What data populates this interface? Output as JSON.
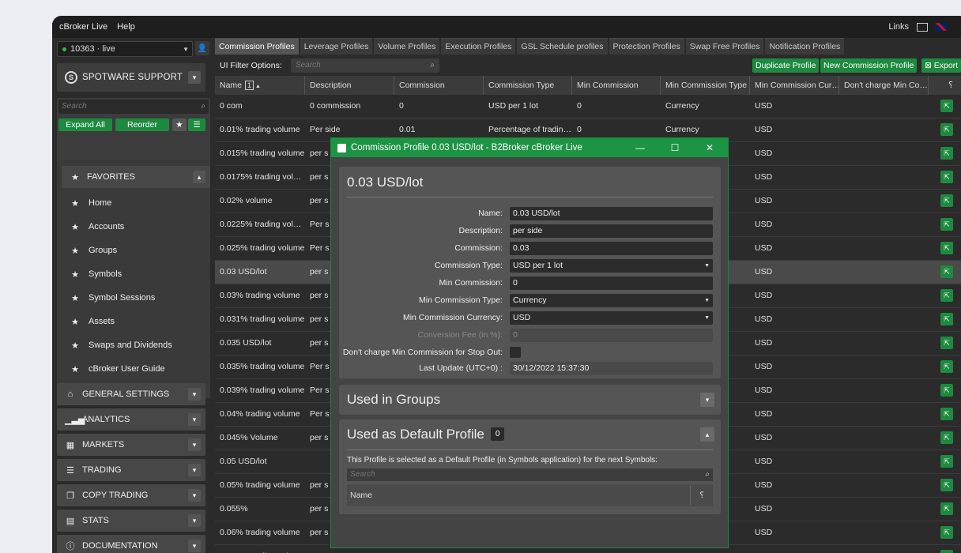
{
  "menu": {
    "app": "cBroker Live",
    "help": "Help",
    "links": "Links"
  },
  "sidebar": {
    "account": "10363 · live",
    "org": "SPOTWARE SUPPORT",
    "search_placeholder": "Search",
    "expand_all": "Expand All",
    "reorder": "Reorder",
    "favorites": "FAVORITES",
    "items": [
      "Home",
      "Accounts",
      "Groups",
      "Symbols",
      "Symbol Sessions",
      "Assets",
      "Swaps and Dividends",
      "cBroker User Guide"
    ],
    "sections": [
      "GENERAL SETTINGS",
      "ANALYTICS",
      "MARKETS",
      "TRADING",
      "COPY TRADING",
      "STATS",
      "DOCUMENTATION"
    ]
  },
  "tabs": [
    "Commission Profiles",
    "Leverage Profiles",
    "Volume Profiles",
    "Execution Profiles",
    "GSL Schedule profiles",
    "Protection Profiles",
    "Swap Free Profiles",
    "Notification Profiles"
  ],
  "filter": {
    "label": "UI Filter Options:",
    "placeholder": "Search",
    "duplicate": "Duplicate Profile",
    "new": "New Commission Profile",
    "export": "Export"
  },
  "table": {
    "columns": [
      "Name",
      "Description",
      "Commission",
      "Commission Type",
      "Min Commission",
      "Min Commission Type",
      "Min Commission Cur…",
      "Don't charge Min Co…"
    ],
    "sort_badge": "1",
    "rows": [
      [
        "0 com",
        "0 commission",
        "0",
        "USD per 1 lot",
        "0",
        "Currency",
        "USD"
      ],
      [
        "0.01% trading volume",
        "Per side",
        "0.01",
        "Percentage of tradin…",
        "0",
        "Currency",
        "USD"
      ],
      [
        "0.015% trading volume",
        "per s",
        "",
        "",
        "",
        "",
        "USD"
      ],
      [
        "0.0175% trading vol…",
        "per s",
        "",
        "",
        "",
        "",
        "USD"
      ],
      [
        "0.02% volume",
        "per s",
        "",
        "",
        "",
        "",
        "USD"
      ],
      [
        "0.0225% trading vol…",
        "Per s",
        "",
        "",
        "",
        "",
        "USD"
      ],
      [
        "0.025% trading volume",
        "Per s",
        "",
        "",
        "",
        "",
        "USD"
      ],
      [
        "0.03 USD/lot",
        "per s",
        "",
        "",
        "",
        "",
        "USD"
      ],
      [
        "0.03% trading volume",
        "per s",
        "",
        "",
        "",
        "",
        "USD"
      ],
      [
        "0.031% trading volume",
        "per s",
        "",
        "",
        "",
        "",
        "USD"
      ],
      [
        "0.035 USD/lot",
        "per s",
        "",
        "",
        "",
        "",
        "USD"
      ],
      [
        "0.035% trading volume",
        "Per s",
        "",
        "",
        "",
        "",
        "USD"
      ],
      [
        "0.039% trading volume",
        "Per s",
        "",
        "",
        "",
        "",
        "USD"
      ],
      [
        "0.04% trading volume",
        "Per s",
        "",
        "",
        "",
        "",
        "USD"
      ],
      [
        "0.045% Volume",
        "per s",
        "",
        "",
        "",
        "",
        "USD"
      ],
      [
        "0.05 USD/lot",
        "",
        "",
        "",
        "",
        "",
        "USD"
      ],
      [
        "0.05% trading volume",
        "per s",
        "",
        "",
        "",
        "",
        "USD"
      ],
      [
        "0.055%",
        "per s",
        "",
        "",
        "",
        "",
        "USD"
      ],
      [
        "0.06% trading volume",
        "per s",
        "",
        "",
        "",
        "",
        "USD"
      ],
      [
        "0.065% trading volume",
        "per s",
        "",
        "",
        "",
        "",
        "USD"
      ]
    ]
  },
  "dialog": {
    "title": "Commission Profile 0.03 USD/lot - B2Broker cBroker Live",
    "heading": "0.03 USD/lot",
    "fields": {
      "name_label": "Name:",
      "name": "0.03 USD/lot",
      "desc_label": "Description:",
      "desc": "per side",
      "comm_label": "Commission:",
      "comm": "0.03",
      "ctype_label": "Commission Type:",
      "ctype": "USD per 1 lot",
      "mincomm_label": "Min Commission:",
      "mincomm": "0",
      "mintype_label": "Min Commission Type:",
      "mintype": "Currency",
      "mincur_label": "Min Commission Currency:",
      "mincur": "USD",
      "fee_label": "Conversion Fee (in %):",
      "fee": "0",
      "stop_label": "Don't charge Min Commission for Stop Out:",
      "update_label": "Last Update (UTC+0) :",
      "update": "30/12/2022 15:37:30"
    },
    "groups_heading": "Used in Groups",
    "default_heading": "Used as Default Profile",
    "default_count": "0",
    "default_desc": "This Profile is selected as a Default Profile (in Symbols application) for the next Symbols:",
    "default_search": "Search",
    "default_col": "Name"
  },
  "colors": {
    "accent": "#1d8a3f",
    "titlebar": "#1d9444"
  }
}
